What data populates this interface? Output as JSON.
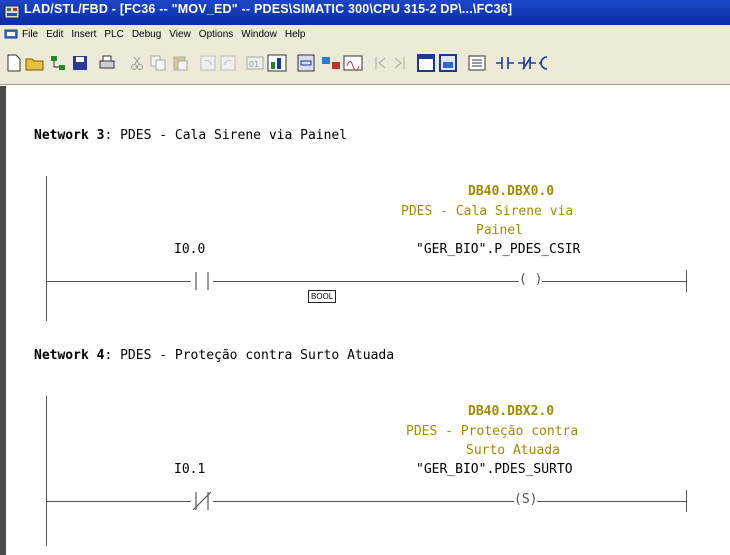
{
  "window": {
    "title": "LAD/STL/FBD  - [FC36 -- \"MOV_ED\" -- PDES\\SIMATIC 300\\CPU 315-2 DP\\...\\FC36]"
  },
  "menu": {
    "items": [
      "File",
      "Edit",
      "Insert",
      "PLC",
      "Debug",
      "View",
      "Options",
      "Window",
      "Help"
    ]
  },
  "toolbar": {
    "buttons": [
      "new-icon",
      "open-icon",
      "network-icon",
      "save-icon",
      "print-icon",
      "cut-icon",
      "copy-icon",
      "paste-icon",
      "undo-icon",
      "redo-icon",
      "download-icon",
      "monitor-icon",
      "overview-icon",
      "compare-icon",
      "online-icon",
      "prev-icon",
      "next-icon",
      "window-icon",
      "details-icon",
      "symbols-icon",
      "contact-no-icon",
      "contact-nc-icon",
      "coil-icon"
    ]
  },
  "networks": [
    {
      "label": "Network 3",
      "separator": ":",
      "title": "PDES - Cala Sirene via Painel",
      "contact": {
        "address": "I0.0",
        "type": "NO"
      },
      "coil": {
        "address": "DB40.DBX0.0",
        "comment_line1": "PDES - Cala Sirene via",
        "comment_line2": "Painel",
        "symbol": "\"GER_BIO\".P_PDES_CSIR",
        "symbol_text": "( )"
      },
      "type_tag": "BOOL"
    },
    {
      "label": "Network 4",
      "separator": ":",
      "title": "PDES - Proteção contra Surto Atuada",
      "contact": {
        "address": "I0.1",
        "type": "NC"
      },
      "coil": {
        "address": "DB40.DBX2.0",
        "comment_line1": "PDES - Proteção contra",
        "comment_line2": "Surto Atuada",
        "symbol": "\"GER_BIO\".PDES_SURTO",
        "symbol_text": "(S)"
      }
    }
  ],
  "colors": {
    "title_bar": "#0a2fa8",
    "comment_text": "#a28a00",
    "rail": "#555555"
  }
}
